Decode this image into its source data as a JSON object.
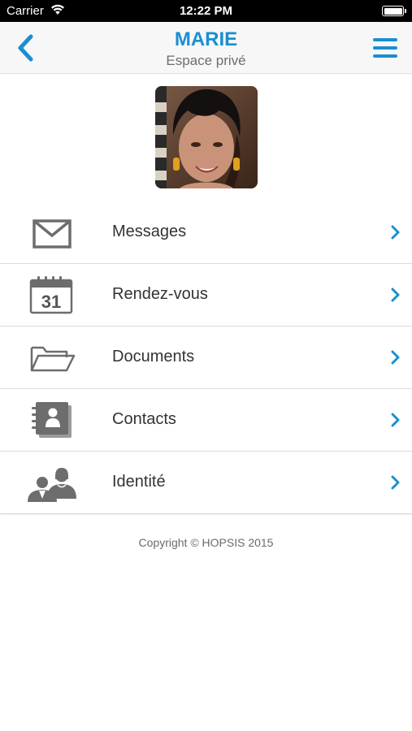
{
  "status_bar": {
    "carrier": "Carrier",
    "time": "12:22 PM"
  },
  "header": {
    "title": "MARIE",
    "subtitle": "Espace privé",
    "back_icon": "chevron-left-icon",
    "menu_icon": "hamburger-menu-icon"
  },
  "profile": {
    "avatar": "profile-photo"
  },
  "menu": {
    "items": [
      {
        "label": "Messages",
        "icon": "envelope-icon"
      },
      {
        "label": "Rendez-vous",
        "icon": "calendar-icon",
        "calendar_day": "31"
      },
      {
        "label": "Documents",
        "icon": "folder-icon"
      },
      {
        "label": "Contacts",
        "icon": "address-book-icon"
      },
      {
        "label": "Identité",
        "icon": "people-icon"
      }
    ]
  },
  "footer": {
    "copyright": "Copyright © HOPSIS 2015"
  },
  "colors": {
    "accent": "#1a8fd1",
    "icon_gray": "#6d6d6d",
    "text": "#333333"
  }
}
